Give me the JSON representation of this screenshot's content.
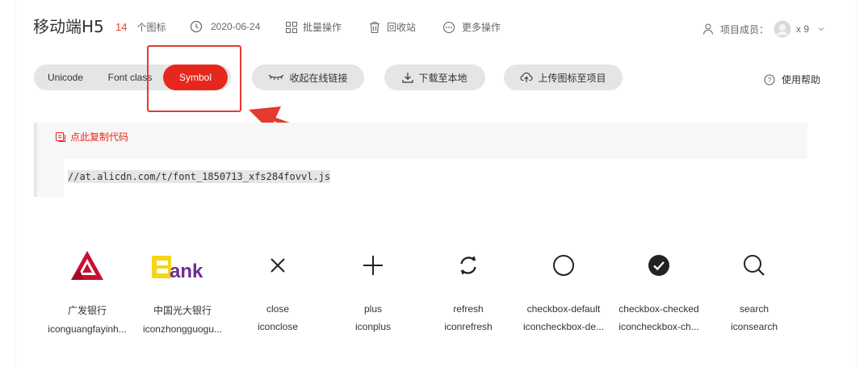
{
  "header": {
    "title": "移动端H5",
    "icon_count": "14",
    "icon_count_unit": "个图标",
    "date": "2020-06-24",
    "batch_ops": "批量操作",
    "recycle_bin": "回收站",
    "more_ops": "更多操作",
    "members_label": "项目成员：",
    "members_count": "x 9"
  },
  "toolbar": {
    "tabs": [
      {
        "label": "Unicode",
        "active": false
      },
      {
        "label": "Font class",
        "active": false
      },
      {
        "label": "Symbol",
        "active": true
      }
    ],
    "collapse_link": "收起在线链接",
    "download": "下载至本地",
    "upload": "上传图标至项目",
    "help": "使用帮助"
  },
  "code_panel": {
    "copy_label": "点此复制代码",
    "code": "//at.alicdn.com/t/font_1850713_xfs284fovvl.js"
  },
  "icons": [
    {
      "name": "广发银行",
      "code": "iconguangfayinh...",
      "glyph": "guangfa-bank-logo-icon"
    },
    {
      "name": "中国光大银行",
      "code": "iconzhongguogu...",
      "glyph": "everbright-bank-logo-icon"
    },
    {
      "name": "close",
      "code": "iconclose",
      "glyph": "close-icon"
    },
    {
      "name": "plus",
      "code": "iconplus",
      "glyph": "plus-icon"
    },
    {
      "name": "refresh",
      "code": "iconrefresh",
      "glyph": "refresh-icon"
    },
    {
      "name": "checkbox-default",
      "code": "iconcheckbox-de...",
      "glyph": "checkbox-default-icon"
    },
    {
      "name": "checkbox-checked",
      "code": "iconcheckbox-ch...",
      "glyph": "checkbox-checked-icon"
    },
    {
      "name": "search",
      "code": "iconsearch",
      "glyph": "search-icon"
    }
  ],
  "colors": {
    "accent": "#e5271d",
    "annotation": "#e53a2e",
    "pill_bg": "#e5e5e5",
    "bank_red": "#c8102e",
    "everbright_yellow": "#f7d417",
    "everbright_purple": "#6b2c91"
  }
}
